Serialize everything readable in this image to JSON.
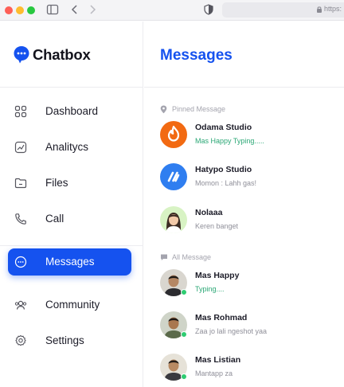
{
  "browser": {
    "url_text": "https:",
    "icons": [
      "sidebar-toggle-icon",
      "back-icon",
      "forward-icon",
      "shield-icon",
      "lock-icon"
    ]
  },
  "brand": {
    "name": "Chatbox",
    "logo_icon": "chat-bubble-logo-icon"
  },
  "sidebar": {
    "items": [
      {
        "label": "Dashboard",
        "icon": "grid-icon",
        "active": false
      },
      {
        "label": "Analitycs",
        "icon": "chart-icon",
        "active": false
      },
      {
        "label": "Files",
        "icon": "folder-icon",
        "active": false
      },
      {
        "label": "Call",
        "icon": "phone-icon",
        "active": false
      },
      {
        "label": "Messages",
        "icon": "message-icon",
        "active": true
      },
      {
        "label": "Community",
        "icon": "users-icon",
        "active": false
      },
      {
        "label": "Settings",
        "icon": "gear-icon",
        "active": false
      }
    ]
  },
  "main": {
    "title": "Messages",
    "pinned_label": "Pinned Message",
    "all_label": "All Message",
    "pinned": [
      {
        "name": "Odama Studio",
        "message": "Mas Happy Typing.....",
        "typing": true
      },
      {
        "name": "Hatypo Studio",
        "message": "Momon : Lahh gas!",
        "typing": false
      },
      {
        "name": "Nolaaa",
        "message": "Keren banget",
        "typing": false
      }
    ],
    "all": [
      {
        "name": "Mas Happy",
        "message": "Typing....",
        "typing": true,
        "online": true
      },
      {
        "name": "Mas Rohmad",
        "message": "Zaa jo lali ngeshot yaa",
        "typing": false,
        "online": true
      },
      {
        "name": "Mas Listian",
        "message": "Mantapp za",
        "typing": false,
        "online": true
      }
    ]
  },
  "colors": {
    "accent": "#1552ef",
    "typing": "#2aa775",
    "online": "#2ecc71",
    "odama": "#f26a12",
    "hatypo": "#2f7ef0",
    "nolaaa_bg": "#d8f3c4"
  }
}
